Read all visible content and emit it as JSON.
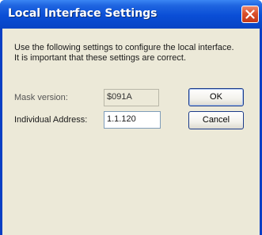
{
  "window": {
    "title": "Local Interface Settings"
  },
  "instructions": {
    "line1": "Use the following settings to configure the local interface.",
    "line2": "It is important that these settings are correct."
  },
  "fields": {
    "mask_label": "Mask version:",
    "mask_value": "$091A",
    "address_label": "Individual Address:",
    "address_value": "1.1.120"
  },
  "buttons": {
    "ok": "OK",
    "cancel": "Cancel"
  },
  "icons": {
    "close": "close-icon"
  }
}
